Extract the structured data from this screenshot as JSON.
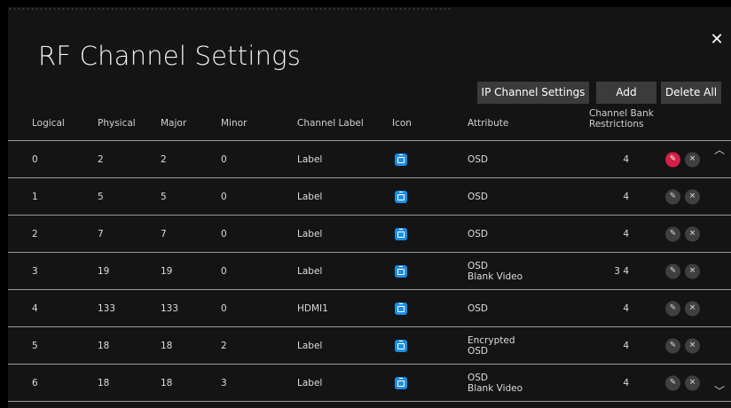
{
  "dialog": {
    "title": "RF Channel Settings",
    "close_icon": "close-icon"
  },
  "toolbar": {
    "ip_channel_settings_label": "IP Channel Settings",
    "add_label": "Add",
    "delete_all_label": "Delete All"
  },
  "table": {
    "headers": {
      "logical": "Logical",
      "physical": "Physical",
      "major": "Major",
      "minor": "Minor",
      "channel_label": "Channel Label",
      "icon": "Icon",
      "attribute": "Attribute",
      "bank_line1": "Channel Bank",
      "bank_line2": "Restrictions"
    },
    "rows": [
      {
        "logical": "0",
        "physical": "2",
        "major": "2",
        "minor": "0",
        "label": "Label",
        "attr1": "OSD",
        "attr2": "",
        "bank": "4"
      },
      {
        "logical": "1",
        "physical": "5",
        "major": "5",
        "minor": "0",
        "label": "Label",
        "attr1": "OSD",
        "attr2": "",
        "bank": "4"
      },
      {
        "logical": "2",
        "physical": "7",
        "major": "7",
        "minor": "0",
        "label": "Label",
        "attr1": "OSD",
        "attr2": "",
        "bank": "4"
      },
      {
        "logical": "3",
        "physical": "19",
        "major": "19",
        "minor": "0",
        "label": "Label",
        "attr1": "OSD",
        "attr2": "Blank Video",
        "bank": "3 4"
      },
      {
        "logical": "4",
        "physical": "133",
        "major": "133",
        "minor": "0",
        "label": "HDMI1",
        "attr1": "OSD",
        "attr2": "",
        "bank": "4"
      },
      {
        "logical": "5",
        "physical": "18",
        "major": "18",
        "minor": "2",
        "label": "Label",
        "attr1": "Encrypted",
        "attr2": "OSD",
        "bank": "4"
      },
      {
        "logical": "6",
        "physical": "18",
        "major": "18",
        "minor": "3",
        "label": "Label",
        "attr1": "OSD",
        "attr2": "Blank Video",
        "bank": "4"
      }
    ],
    "icon_name": "tv-channel-icon",
    "edit_icon": "pencil-icon",
    "delete_icon": "x-circle-icon"
  },
  "scroll": {
    "up_icon": "chevron-up-icon",
    "down_icon": "chevron-down-icon"
  },
  "colors": {
    "background": "#141414",
    "button": "#3b3b3b",
    "active_edit": "#d61f46",
    "icon_blue": "#1a8fe6"
  }
}
